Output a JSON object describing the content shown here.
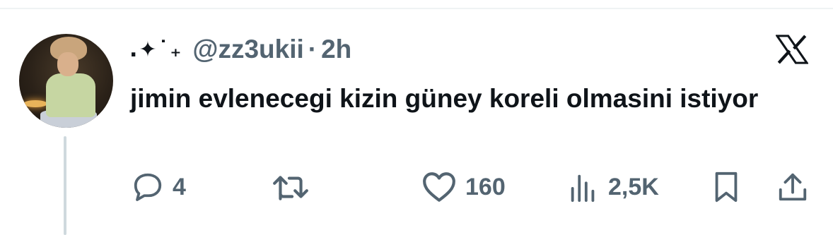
{
  "tweet": {
    "display_name": ".✦˙₊",
    "handle": "@zz3ukii",
    "separator": "·",
    "time": "2h",
    "text": "jimin evlenecegi kizin güney koreli olmasini istiyor"
  },
  "actions": {
    "replies": "4",
    "retweets": "",
    "likes": "160",
    "views": "2,5K"
  },
  "colors": {
    "text": "#0f1419",
    "secondary": "#536471",
    "thread_line": "#cfd9de"
  },
  "icons": [
    "reply-icon",
    "retweet-icon",
    "like-icon",
    "views-icon",
    "bookmark-icon",
    "share-icon",
    "x-logo-icon"
  ]
}
